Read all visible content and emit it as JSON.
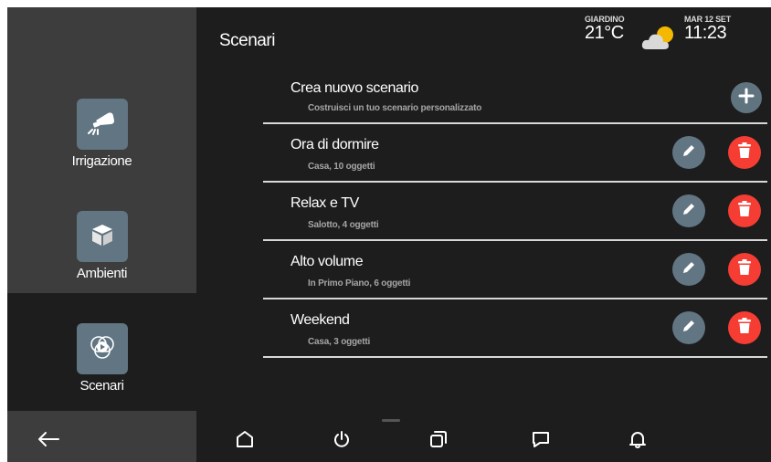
{
  "header": {
    "title": "Scenari",
    "weather_location": "GIARDINO",
    "temperature": "21°C",
    "weather_icon": "partly-cloudy-icon",
    "date": "MAR 12 SET",
    "time": "11:23"
  },
  "sidebar": {
    "items": [
      {
        "label": "Irrigazione",
        "icon": "sprinkler-icon"
      },
      {
        "label": "Ambienti",
        "icon": "cube-icon"
      },
      {
        "label": "Scenari",
        "icon": "scenario-icon",
        "selected": true
      }
    ]
  },
  "list": {
    "create": {
      "title": "Crea nuovo scenario",
      "subtitle": "Costruisci un tuo scenario personalizzato"
    },
    "scenarios": [
      {
        "title": "Ora di dormire",
        "subtitle": "Casa, 10 oggetti"
      },
      {
        "title": "Relax e TV",
        "subtitle": "Salotto, 4 oggetti"
      },
      {
        "title": "Alto volume",
        "subtitle": "In Primo Piano, 6 oggetti"
      },
      {
        "title": "Weekend",
        "subtitle": "Casa, 3 oggetti"
      }
    ]
  },
  "bottom_nav": {
    "items": [
      "back-arrow-icon",
      "home-icon",
      "power-icon",
      "windows-icon",
      "chat-icon",
      "bell-icon"
    ]
  },
  "colors": {
    "background": "#1d1d1d",
    "sidebar": "#3d3d3d",
    "tile": "#617582",
    "delete": "#f53d34",
    "divider": "#d8d8d8"
  }
}
